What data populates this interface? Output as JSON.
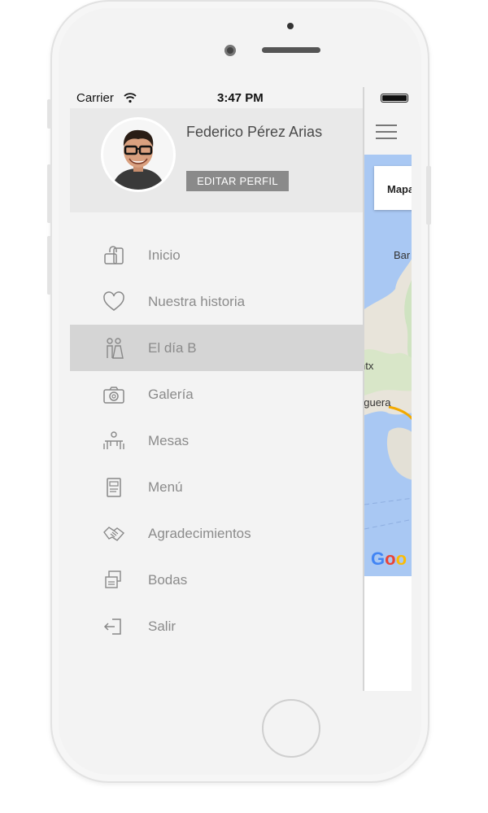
{
  "status_bar": {
    "carrier": "Carrier",
    "time": "3:47 PM"
  },
  "profile": {
    "name": "Federico Pérez Arias",
    "edit_label": "EDITAR PERFIL"
  },
  "menu": {
    "items": [
      {
        "label": "Inicio",
        "icon": "home-lock-icon",
        "active": false
      },
      {
        "label": "Nuestra historia",
        "icon": "heart-icon",
        "active": false
      },
      {
        "label": "El día B",
        "icon": "couple-icon",
        "active": true
      },
      {
        "label": "Galería",
        "icon": "camera-icon",
        "active": false
      },
      {
        "label": "Mesas",
        "icon": "table-icon",
        "active": false
      },
      {
        "label": "Menú",
        "icon": "menu-card-icon",
        "active": false
      },
      {
        "label": "Agradecimientos",
        "icon": "handshake-icon",
        "active": false
      },
      {
        "label": "Bodas",
        "icon": "photos-icon",
        "active": false
      },
      {
        "label": "Salir",
        "icon": "logout-icon",
        "active": false
      }
    ]
  },
  "map_view": {
    "button_label": "Mapa",
    "labels": [
      "Bar",
      "ntx",
      "eguera"
    ],
    "attribution": "Goo"
  },
  "colors": {
    "active_item": "#d5d5d5",
    "profile_bg": "#e9e9e9",
    "edit_button": "#8a8a8a",
    "map_water": "#a9c8f3"
  }
}
